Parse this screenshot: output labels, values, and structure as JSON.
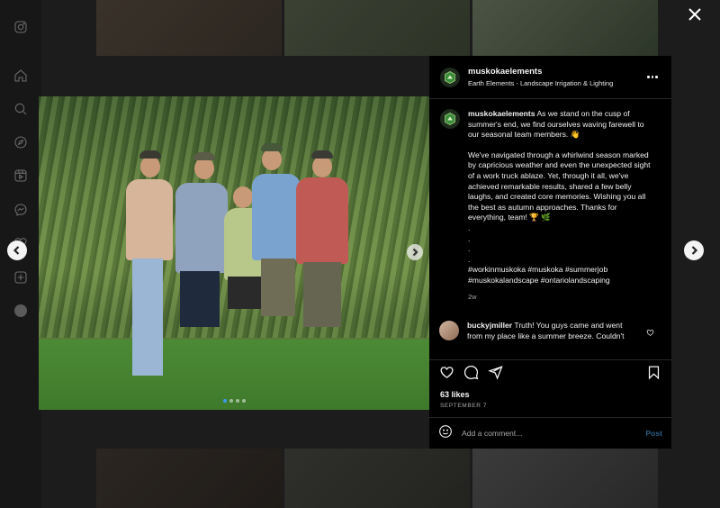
{
  "colors": {
    "accent": "#0095f6",
    "background": "#000000",
    "overlay": "#1c1c1c"
  },
  "rail": {
    "icons": [
      "instagram-icon",
      "home-icon",
      "search-icon",
      "explore-icon",
      "reels-icon",
      "messenger-icon",
      "heart-icon",
      "create-icon",
      "profile-avatar"
    ]
  },
  "post": {
    "username": "muskokaelements",
    "subtitle": "Earth Elements - Landscape Irrigation & Lighting",
    "caption": {
      "username": "muskokaelements",
      "intro": "As we stand on the cusp of summer's end, we find ourselves waving farewell to our seasonal team members. 👋",
      "body": "We've navigated through a whirlwind season marked by capricious weather and even the unexpected sight of a work truck ablaze. Yet, through it all, we've achieved remarkable results, shared a few belly laughs, and created core memories. Wishing you all the best as autumn approaches. Thanks for everything, team! 🏆 🌿",
      "dot1": ".",
      "dot2": ".",
      "dot3": ".",
      "dot4": ".",
      "hashtags": "#workinmuskoka #muskoka #summerjob #muskokalandscape #ontariolandscaping",
      "time": "2w"
    },
    "comment": {
      "username": "buckyjmiller",
      "text": "Truth! You guys came and went from my place like a summer breeze. Couldn't"
    },
    "likes": "63 likes",
    "date": "SEPTEMBER 7",
    "add_comment_placeholder": "Add a comment...",
    "post_label": "Post",
    "carousel": {
      "count": 4,
      "active_index": 0
    }
  }
}
